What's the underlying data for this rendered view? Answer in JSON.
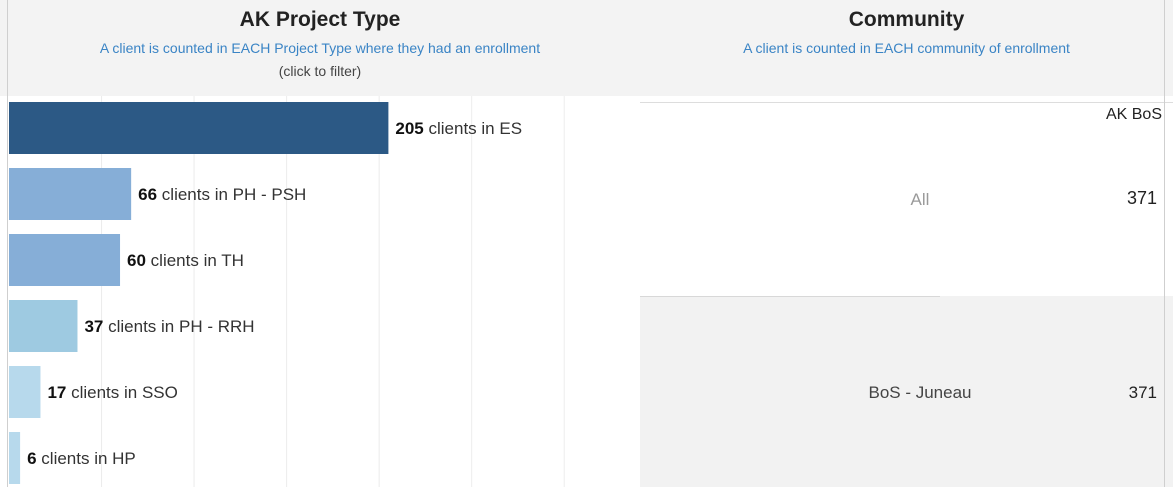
{
  "left_panel": {
    "title": "AK Project Type",
    "subtitle": "A client is counted in EACH Project Type where they had an enrollment",
    "note": "(click to filter)"
  },
  "right_panel": {
    "title": "Community",
    "subtitle": "A client is counted in EACH community of enrollment",
    "column_header": "AK BoS",
    "rows": [
      {
        "label": "All",
        "value": "371"
      },
      {
        "label": "BoS - Juneau",
        "value": "371"
      }
    ]
  },
  "chart_data": {
    "type": "bar",
    "orientation": "horizontal",
    "categories": [
      "ES",
      "PH - PSH",
      "TH",
      "PH - RRH",
      "SSO",
      "HP"
    ],
    "values": [
      205,
      66,
      60,
      37,
      17,
      6
    ],
    "label_prefix_text": " clients in ",
    "xlim": [
      0,
      335
    ],
    "grid": true,
    "colors": [
      "#2c5985",
      "#86aed7",
      "#86aed7",
      "#9ecae1",
      "#b7d9ec",
      "#b7d9ec"
    ]
  }
}
